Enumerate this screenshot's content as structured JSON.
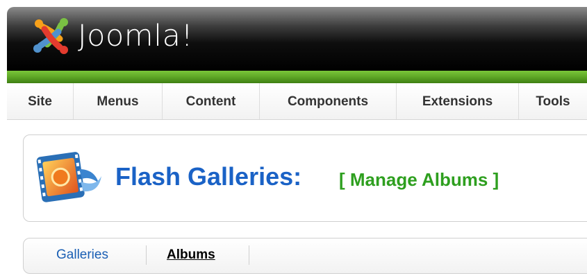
{
  "header": {
    "logo_text": "Joomla!",
    "colors": {
      "background": "#000000",
      "accent_bar": "#5ea626"
    }
  },
  "menu": {
    "items": [
      {
        "label": "Site"
      },
      {
        "label": "Menus"
      },
      {
        "label": "Content"
      },
      {
        "label": "Components"
      },
      {
        "label": "Extensions"
      },
      {
        "label": "Tools"
      }
    ]
  },
  "page": {
    "icon": "film-gallery-icon",
    "title": "Flash Galleries:",
    "subtitle": "[ Manage Albums ]",
    "colors": {
      "title": "#1a62c6",
      "subtitle": "#2e9f1f"
    }
  },
  "tabs": {
    "items": [
      {
        "label": "Galleries",
        "active": false
      },
      {
        "label": "Albums",
        "active": true
      }
    ]
  }
}
